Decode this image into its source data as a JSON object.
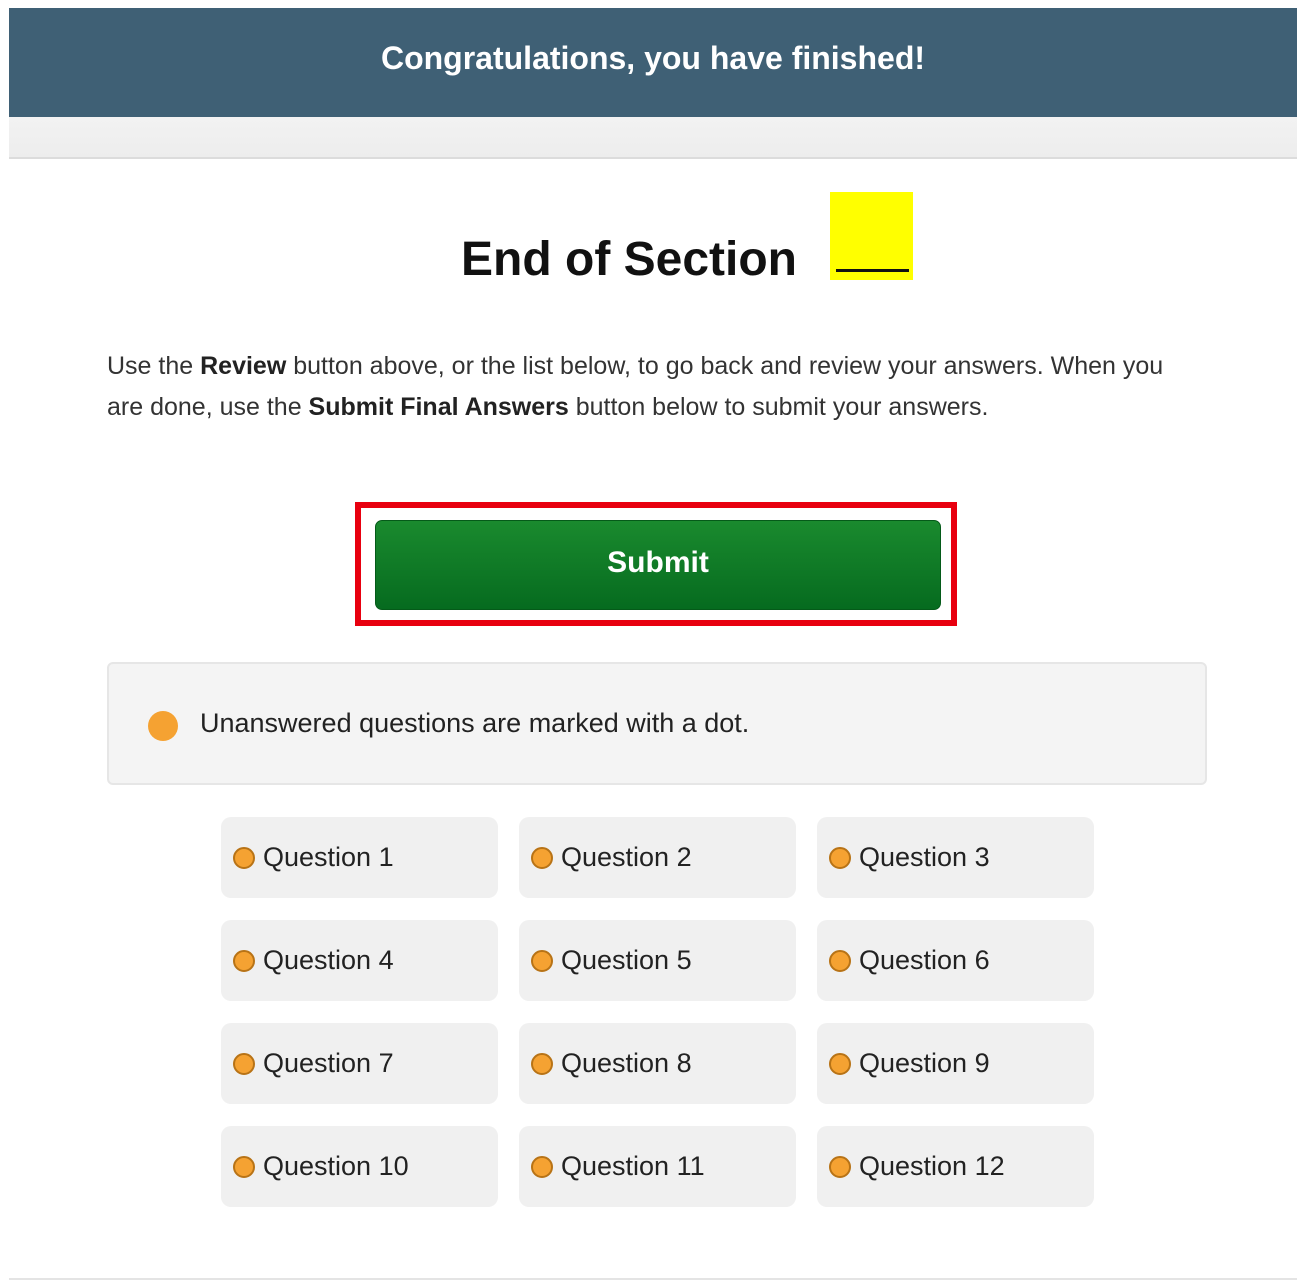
{
  "banner": {
    "message": "Congratulations, you have finished!"
  },
  "header": {
    "title": "End of Section",
    "section_blank": ""
  },
  "instructions": {
    "part1": "Use the ",
    "review_label": "Review",
    "part2": " button above, or the list below, to go back and review your answers. When you are done, use the ",
    "submit_final_label": "Submit Final Answers",
    "part3": " button below to submit your answers."
  },
  "submit": {
    "label": "Submit"
  },
  "legend": {
    "text": "Unanswered questions are marked with a dot."
  },
  "questions": [
    {
      "label": "Question 1",
      "answered": false
    },
    {
      "label": "Question 2",
      "answered": false
    },
    {
      "label": "Question 3",
      "answered": false
    },
    {
      "label": "Question 4",
      "answered": false
    },
    {
      "label": "Question 5",
      "answered": false
    },
    {
      "label": "Question 6",
      "answered": false
    },
    {
      "label": "Question 7",
      "answered": false
    },
    {
      "label": "Question 8",
      "answered": false
    },
    {
      "label": "Question 9",
      "answered": false
    },
    {
      "label": "Question 10",
      "answered": false
    },
    {
      "label": "Question 11",
      "answered": false
    },
    {
      "label": "Question 12",
      "answered": false
    }
  ],
  "colors": {
    "banner": "#3f6075",
    "submit_green": "#0a7a24",
    "highlight_outline": "#e8000f",
    "unanswered_dot": "#f5a232",
    "redaction_yellow": "#ffff00"
  }
}
